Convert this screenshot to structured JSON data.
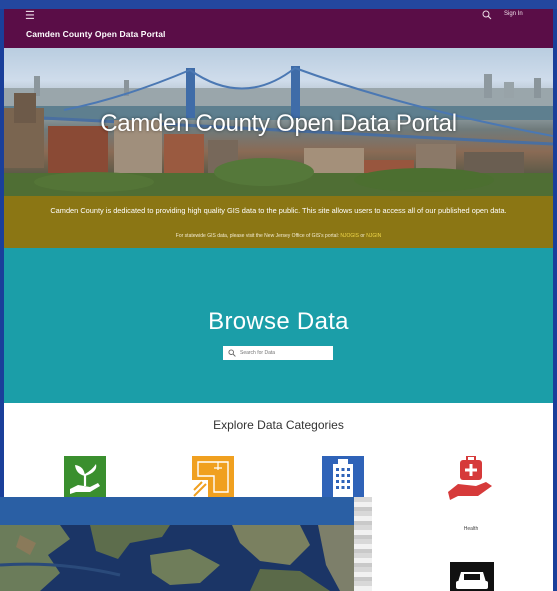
{
  "header": {
    "brand": "Camden County Open Data Portal",
    "sign_in": "Sign In"
  },
  "hero": {
    "title": "Camden County Open Data Portal"
  },
  "description": {
    "main": "Camden County is dedicated to providing high quality GIS data to the public. This site allows users to access all of our published open data.",
    "sub_prefix": "For statewide GIS data, please visit the New Jersey Office of GIS's portal: ",
    "link1": "NJOGIS",
    "sub_mid": " or ",
    "link2": "NJGIN"
  },
  "browse": {
    "title": "Browse Data",
    "search_placeholder": "Search for Data"
  },
  "explore": {
    "title": "Explore Data Categories",
    "categories": [
      {
        "icon": "plant-in-hand-icon",
        "label": "",
        "color": "#3a8f2e"
      },
      {
        "icon": "blueprint-icon",
        "label": "",
        "color": "#f0a020"
      },
      {
        "icon": "building-icon",
        "label": "",
        "color": "#2f63b8"
      },
      {
        "icon": "medical-kit-hand-icon",
        "label": "Health",
        "color": "#d63a3a"
      },
      {
        "icon": "car-icon",
        "label": "",
        "color": "#111111"
      }
    ]
  },
  "colors": {
    "header": "#5a0d47",
    "band": "#8b7614",
    "browse": "#1b9ea8",
    "frame": "#1a3f9a"
  }
}
